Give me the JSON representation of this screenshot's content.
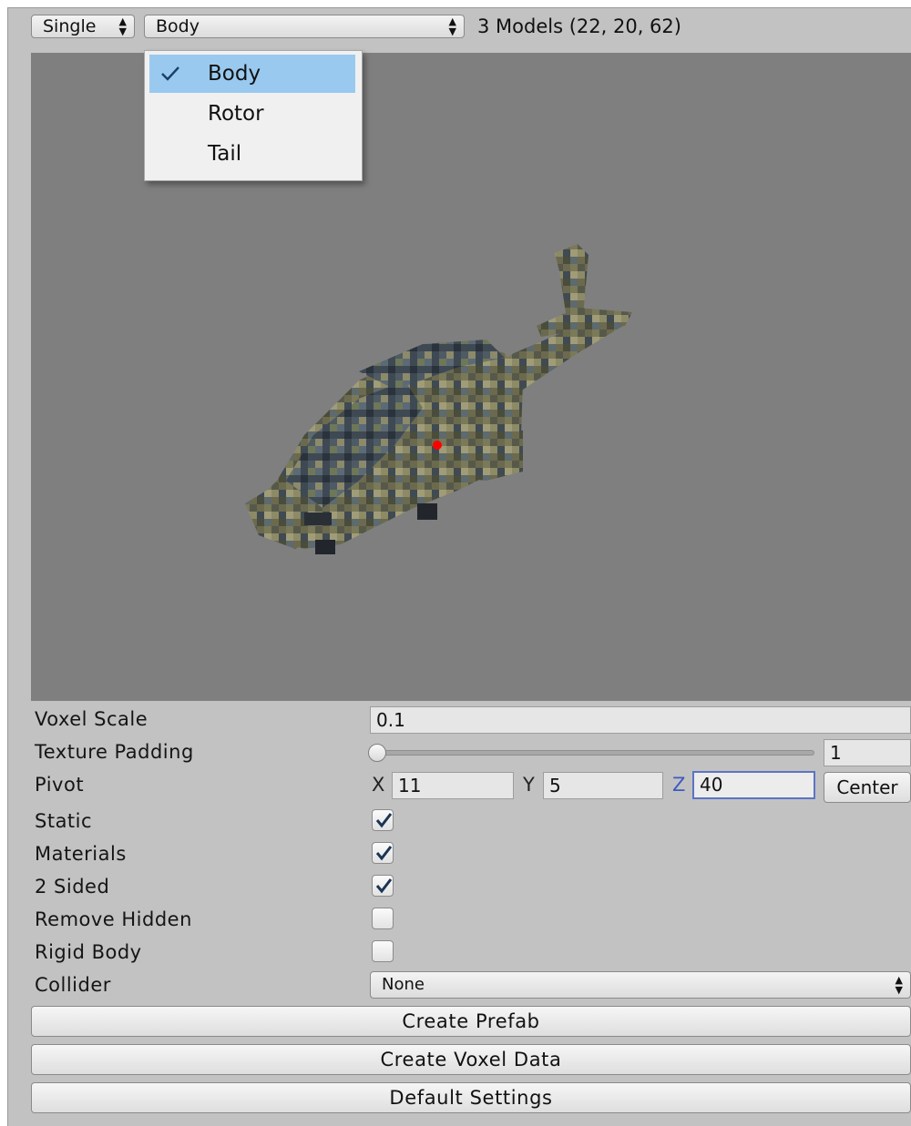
{
  "toolbar": {
    "mode_value": "Single",
    "model_value": "Body",
    "models_info": "3 Models (22, 20, 62)"
  },
  "model_menu": {
    "items": [
      {
        "label": "Body",
        "selected": true
      },
      {
        "label": "Rotor",
        "selected": false
      },
      {
        "label": "Tail",
        "selected": false
      }
    ]
  },
  "properties": {
    "voxel_scale": {
      "label": "Voxel Scale",
      "value": "0.1"
    },
    "texture_padding": {
      "label": "Texture Padding",
      "value": "1",
      "slider_fraction": 0.0
    },
    "pivot": {
      "label": "Pivot",
      "x_label": "X",
      "x_value": "11",
      "y_label": "Y",
      "y_value": "5",
      "z_label": "Z",
      "z_value": "40",
      "center_label": "Center"
    },
    "static": {
      "label": "Static",
      "checked": true
    },
    "materials": {
      "label": "Materials",
      "checked": true
    },
    "two_sided": {
      "label": "2 Sided",
      "checked": true
    },
    "remove_hidden": {
      "label": "Remove Hidden",
      "checked": false
    },
    "rigid_body": {
      "label": "Rigid Body",
      "checked": false
    },
    "collider": {
      "label": "Collider",
      "value": "None"
    }
  },
  "buttons": {
    "create_prefab": "Create Prefab",
    "create_voxel_data": "Create Voxel Data",
    "default_settings": "Default Settings"
  },
  "colors": {
    "panel_bg": "#c2c2c2",
    "viewport_bg": "#7f7f7f",
    "menu_highlight": "#99c9ef",
    "focus_blue": "#5b74c6",
    "pivot_marker": "#ff0000"
  }
}
